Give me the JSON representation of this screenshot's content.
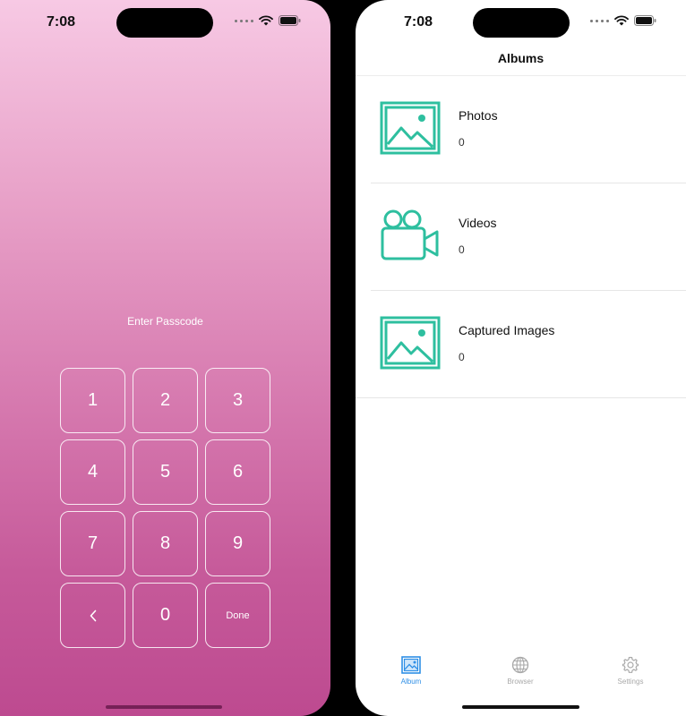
{
  "colors": {
    "accent_teal": "#2ebf9f",
    "tab_active": "#2f8fe6",
    "tab_inactive": "#a9a9a9",
    "gradient_top": "#f7c9e4",
    "gradient_bottom": "#bd4a90"
  },
  "left_phone": {
    "status_time": "7:08",
    "prompt": "Enter Passcode",
    "keys": [
      "1",
      "2",
      "3",
      "4",
      "5",
      "6",
      "7",
      "8",
      "9",
      "<",
      "0",
      "Done"
    ]
  },
  "right_phone": {
    "status_time": "7:08",
    "nav_title": "Albums",
    "albums": [
      {
        "title": "Photos",
        "count": "0",
        "icon": "photo-icon"
      },
      {
        "title": "Videos",
        "count": "0",
        "icon": "video-camera-icon"
      },
      {
        "title": "Captured Images",
        "count": "0",
        "icon": "photo-icon"
      }
    ],
    "tabs": [
      {
        "label": "Album",
        "icon": "album-tab-icon",
        "active": true
      },
      {
        "label": "Browser",
        "icon": "globe-icon",
        "active": false
      },
      {
        "label": "Settings",
        "icon": "gear-icon",
        "active": false
      }
    ]
  }
}
